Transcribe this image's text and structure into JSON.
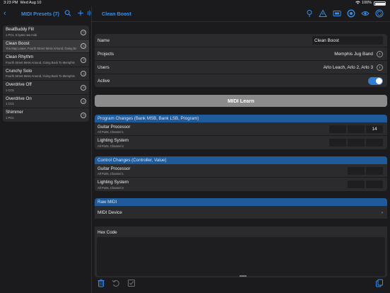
{
  "status_bar": {
    "time": "3:23 PM",
    "date": "Wed Aug 10",
    "battery_pct": "100%",
    "wifi_icon": "wifi-icon"
  },
  "left": {
    "title": "MIDI Presets (7)",
    "icons": [
      "back-chevron-icon",
      "search-icon",
      "add-icon",
      "waveform-icon"
    ],
    "presets": [
      {
        "name": "BeatBuddy Fill",
        "desc": "1 PCs, 8 bytes raw midi",
        "selected": false
      },
      {
        "name": "Clean Boost",
        "desc": "You May Leave, Fourth Street Mess Around, Going Back To...",
        "selected": true
      },
      {
        "name": "Clean Rhythm",
        "desc": "Fourth Street Mess Around, Going Back To Memphis",
        "selected": false
      },
      {
        "name": "Crunchy Solo",
        "desc": "Fourth Street Mess Around, Going Back To Memphis",
        "selected": false
      },
      {
        "name": "Overdrive Off",
        "desc": "1 CCs",
        "selected": false
      },
      {
        "name": "Overdrive On",
        "desc": "1 CCs",
        "selected": false
      },
      {
        "name": "Shimmer",
        "desc": "1 PCs",
        "selected": false
      }
    ]
  },
  "right": {
    "title": "Clean Boost",
    "toolbar_icons": [
      "lightbulb-icon",
      "warning-icon",
      "screen-icon",
      "metronome-icon",
      "visibility-icon",
      "sync-icon"
    ],
    "name": {
      "label": "Name",
      "value": "Clean Boost"
    },
    "projects": {
      "label": "Projects",
      "value": "Memphis Jug Band"
    },
    "users": {
      "label": "Users",
      "value": "Arlo Leach, Arlo 2, Arlo 3"
    },
    "active": {
      "label": "Active",
      "on": true
    },
    "midi_learn": "MIDI Learn",
    "program_changes": {
      "header": "Program Changes (Bank MSB, Bank LSB, Program)",
      "rows": [
        {
          "name": "Guitar Processor",
          "sub": "All Ports, Channel 1",
          "cells": [
            "",
            "",
            "14"
          ]
        },
        {
          "name": "Lighting System",
          "sub": "All Ports, Channel 2",
          "cells": [
            "",
            "",
            ""
          ]
        }
      ]
    },
    "control_changes": {
      "header": "Control Changes (Controller, Value)",
      "rows": [
        {
          "name": "Guitar Processor",
          "sub": "All Ports, Channel 1",
          "cells": [
            "",
            ""
          ]
        },
        {
          "name": "Lighting System",
          "sub": "All Ports, Channel 2",
          "cells": [
            "",
            ""
          ]
        }
      ]
    },
    "raw_midi": {
      "header": "Raw MIDI",
      "device_label": "MIDI Device",
      "hex_label": "Hex Code",
      "hex_value": ""
    },
    "bottom_icons": [
      "trash-icon",
      "undo-icon",
      "checklist-icon",
      "copy-icon"
    ]
  },
  "colors": {
    "accent": "#3a8ee6",
    "section_header": "#1f5a9a",
    "toggle_on": "#2f7fd6"
  }
}
